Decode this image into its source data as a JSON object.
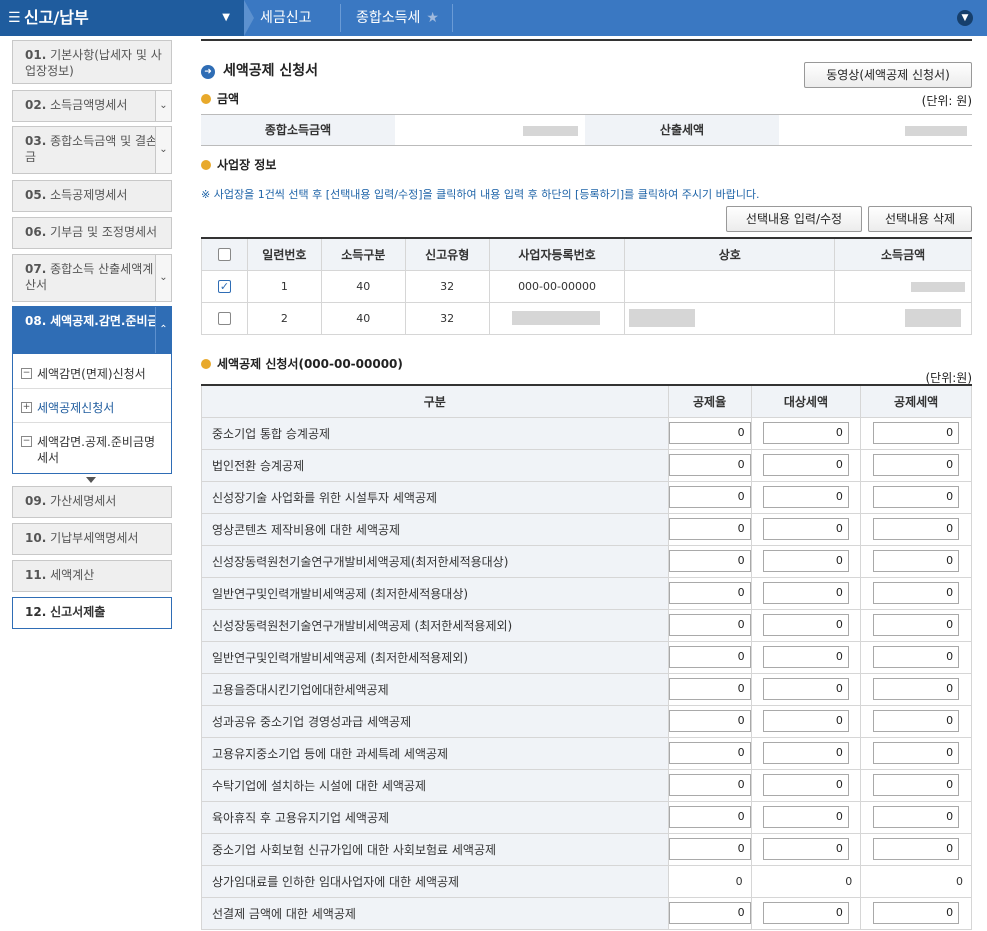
{
  "topbar": {
    "menu_title": "신고/납부",
    "crumbs": [
      "세금신고",
      "종합소득세"
    ]
  },
  "sidebar": {
    "items": [
      {
        "num": "01.",
        "label": "기본사항(납세자 및 사업장정보)"
      },
      {
        "num": "02.",
        "label": "소득금액명세서"
      },
      {
        "num": "03.",
        "label": "종합소득금액 및 결손금"
      },
      {
        "num": "05.",
        "label": "소득공제명세서"
      },
      {
        "num": "06.",
        "label": "기부금 및 조정명세서"
      },
      {
        "num": "07.",
        "label": "종합소득 산출세액계산서"
      },
      {
        "num": "08.",
        "label": "세액공제.감면.준비금"
      },
      {
        "num": "09.",
        "label": "가산세명세서"
      },
      {
        "num": "10.",
        "label": "기납부세액명세서"
      },
      {
        "num": "11.",
        "label": "세액계산"
      },
      {
        "num": "12.",
        "label": "신고서제출"
      }
    ],
    "subitems": [
      "세액감면(면제)신청서",
      "세액공제신청서",
      "세액감면.공제.준비금명세서"
    ]
  },
  "main": {
    "title": "세액공제 신청서",
    "video_button": "동영상(세액공제 신청서)",
    "amount_section": "금액",
    "unit1": "(단위: 원)",
    "total_income_label": "종합소득금액",
    "calc_tax_label": "산출세액",
    "biz_section": "사업장 정보",
    "notice": "※ 사업장을 1건씩 선택 후 [선택내용 입력/수정]을 클릭하여 내용 입력 후 하단의 [등록하기]를 클릭하여 주시기 바랍니다.",
    "edit_button": "선택내용 입력/수정",
    "delete_button": "선택내용 삭제",
    "biz_headers": [
      "일련번호",
      "소득구분",
      "신고유형",
      "사업자등록번호",
      "상호",
      "소득금액"
    ],
    "biz_rows": [
      {
        "seq": "1",
        "income_type": "40",
        "report_type": "32",
        "bizno": "000-00-00000",
        "checked": true
      },
      {
        "seq": "2",
        "income_type": "40",
        "report_type": "32",
        "bizno": "",
        "checked": false
      }
    ],
    "deduction_section": "세액공제 신청서(000-00-00000)",
    "unit2": "(단위:원)",
    "ded_headers": [
      "구분",
      "공제율",
      "대상세액",
      "공제세액"
    ],
    "ded_rows": [
      {
        "label": "중소기업 통합 승계공제",
        "rate": "0",
        "target": "0",
        "deduct": "0",
        "readonly": false
      },
      {
        "label": "법인전환 승계공제",
        "rate": "0",
        "target": "0",
        "deduct": "0",
        "readonly": false
      },
      {
        "label": "신성장기술 사업화를 위한 시설투자 세액공제",
        "rate": "0",
        "target": "0",
        "deduct": "0",
        "readonly": false
      },
      {
        "label": "영상콘텐츠 제작비용에 대한 세액공제",
        "rate": "0",
        "target": "0",
        "deduct": "0",
        "readonly": false
      },
      {
        "label": "신성장동력원천기술연구개발비세액공제(최저한세적용대상)",
        "rate": "0",
        "target": "0",
        "deduct": "0",
        "readonly": false
      },
      {
        "label": "일반연구및인력개발비세액공제 (최저한세적용대상)",
        "rate": "0",
        "target": "0",
        "deduct": "0",
        "readonly": false
      },
      {
        "label": "신성장동력원천기술연구개발비세액공제 (최저한세적용제외)",
        "rate": "0",
        "target": "0",
        "deduct": "0",
        "readonly": false
      },
      {
        "label": "일반연구및인력개발비세액공제 (최저한세적용제외)",
        "rate": "0",
        "target": "0",
        "deduct": "0",
        "readonly": false
      },
      {
        "label": "고용을증대시킨기업에대한세액공제",
        "rate": "0",
        "target": "0",
        "deduct": "0",
        "readonly": false
      },
      {
        "label": "성과공유 중소기업 경영성과급 세액공제",
        "rate": "0",
        "target": "0",
        "deduct": "0",
        "readonly": false
      },
      {
        "label": "고용유지중소기업 등에 대한 과세특례 세액공제",
        "rate": "0",
        "target": "0",
        "deduct": "0",
        "readonly": false
      },
      {
        "label": "수탁기업에 설치하는 시설에 대한 세액공제",
        "rate": "0",
        "target": "0",
        "deduct": "0",
        "readonly": false
      },
      {
        "label": "육아휴직 후 고용유지기업 세액공제",
        "rate": "0",
        "target": "0",
        "deduct": "0",
        "readonly": false
      },
      {
        "label": "중소기업 사회보험 신규가입에 대한 사회보험료 세액공제",
        "rate": "0",
        "target": "0",
        "deduct": "0",
        "readonly": false
      },
      {
        "label": "상가임대료를 인하한 임대사업자에 대한 세액공제",
        "rate": "0",
        "target": "0",
        "deduct": "0",
        "readonly": true
      },
      {
        "label": "선결제 금액에 대한 세액공제",
        "rate": "0",
        "target": "0",
        "deduct": "0",
        "readonly": false
      }
    ]
  }
}
